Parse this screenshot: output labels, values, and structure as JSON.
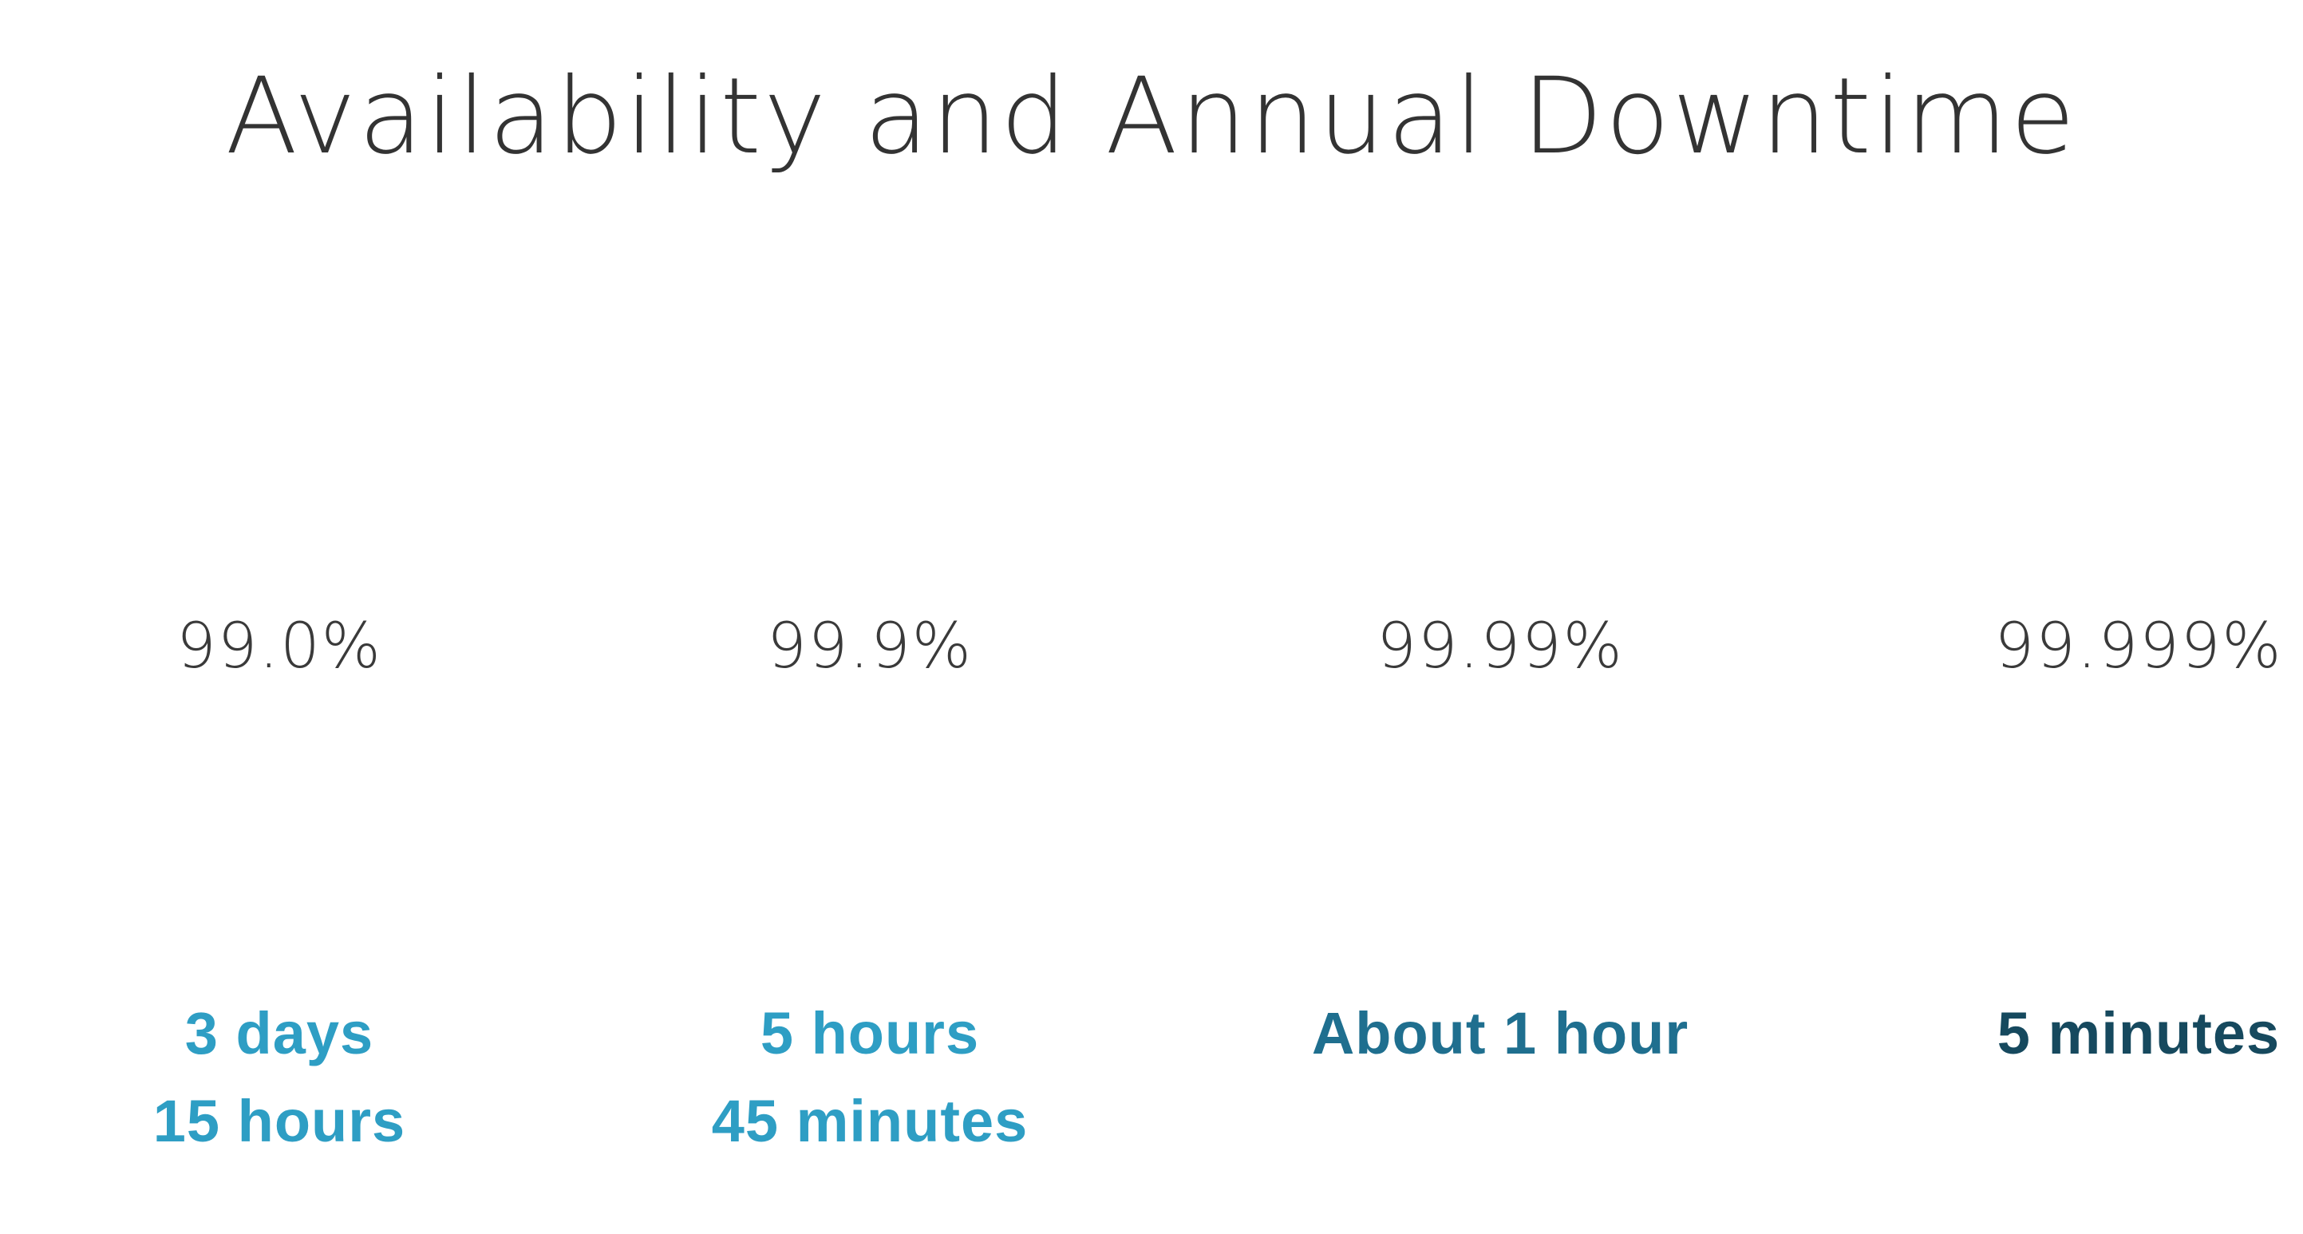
{
  "title": "Availability and Annual Downtime",
  "colors": {
    "title": "#333333",
    "percent": "#3a3a3a",
    "tier_1": "#2e9ec4",
    "tier_2": "#2e9ec4",
    "tier_3": "#1f6f8f",
    "tier_4": "#16495e"
  },
  "tiers": [
    {
      "availability": "99.0%",
      "downtime_lines": [
        "3 days",
        "15 hours"
      ]
    },
    {
      "availability": "99.9%",
      "downtime_lines": [
        "5 hours",
        "45 minutes"
      ]
    },
    {
      "availability": "99.99%",
      "downtime_lines": [
        "About 1 hour"
      ]
    },
    {
      "availability": "99.999%",
      "downtime_lines": [
        "5 minutes"
      ]
    }
  ]
}
